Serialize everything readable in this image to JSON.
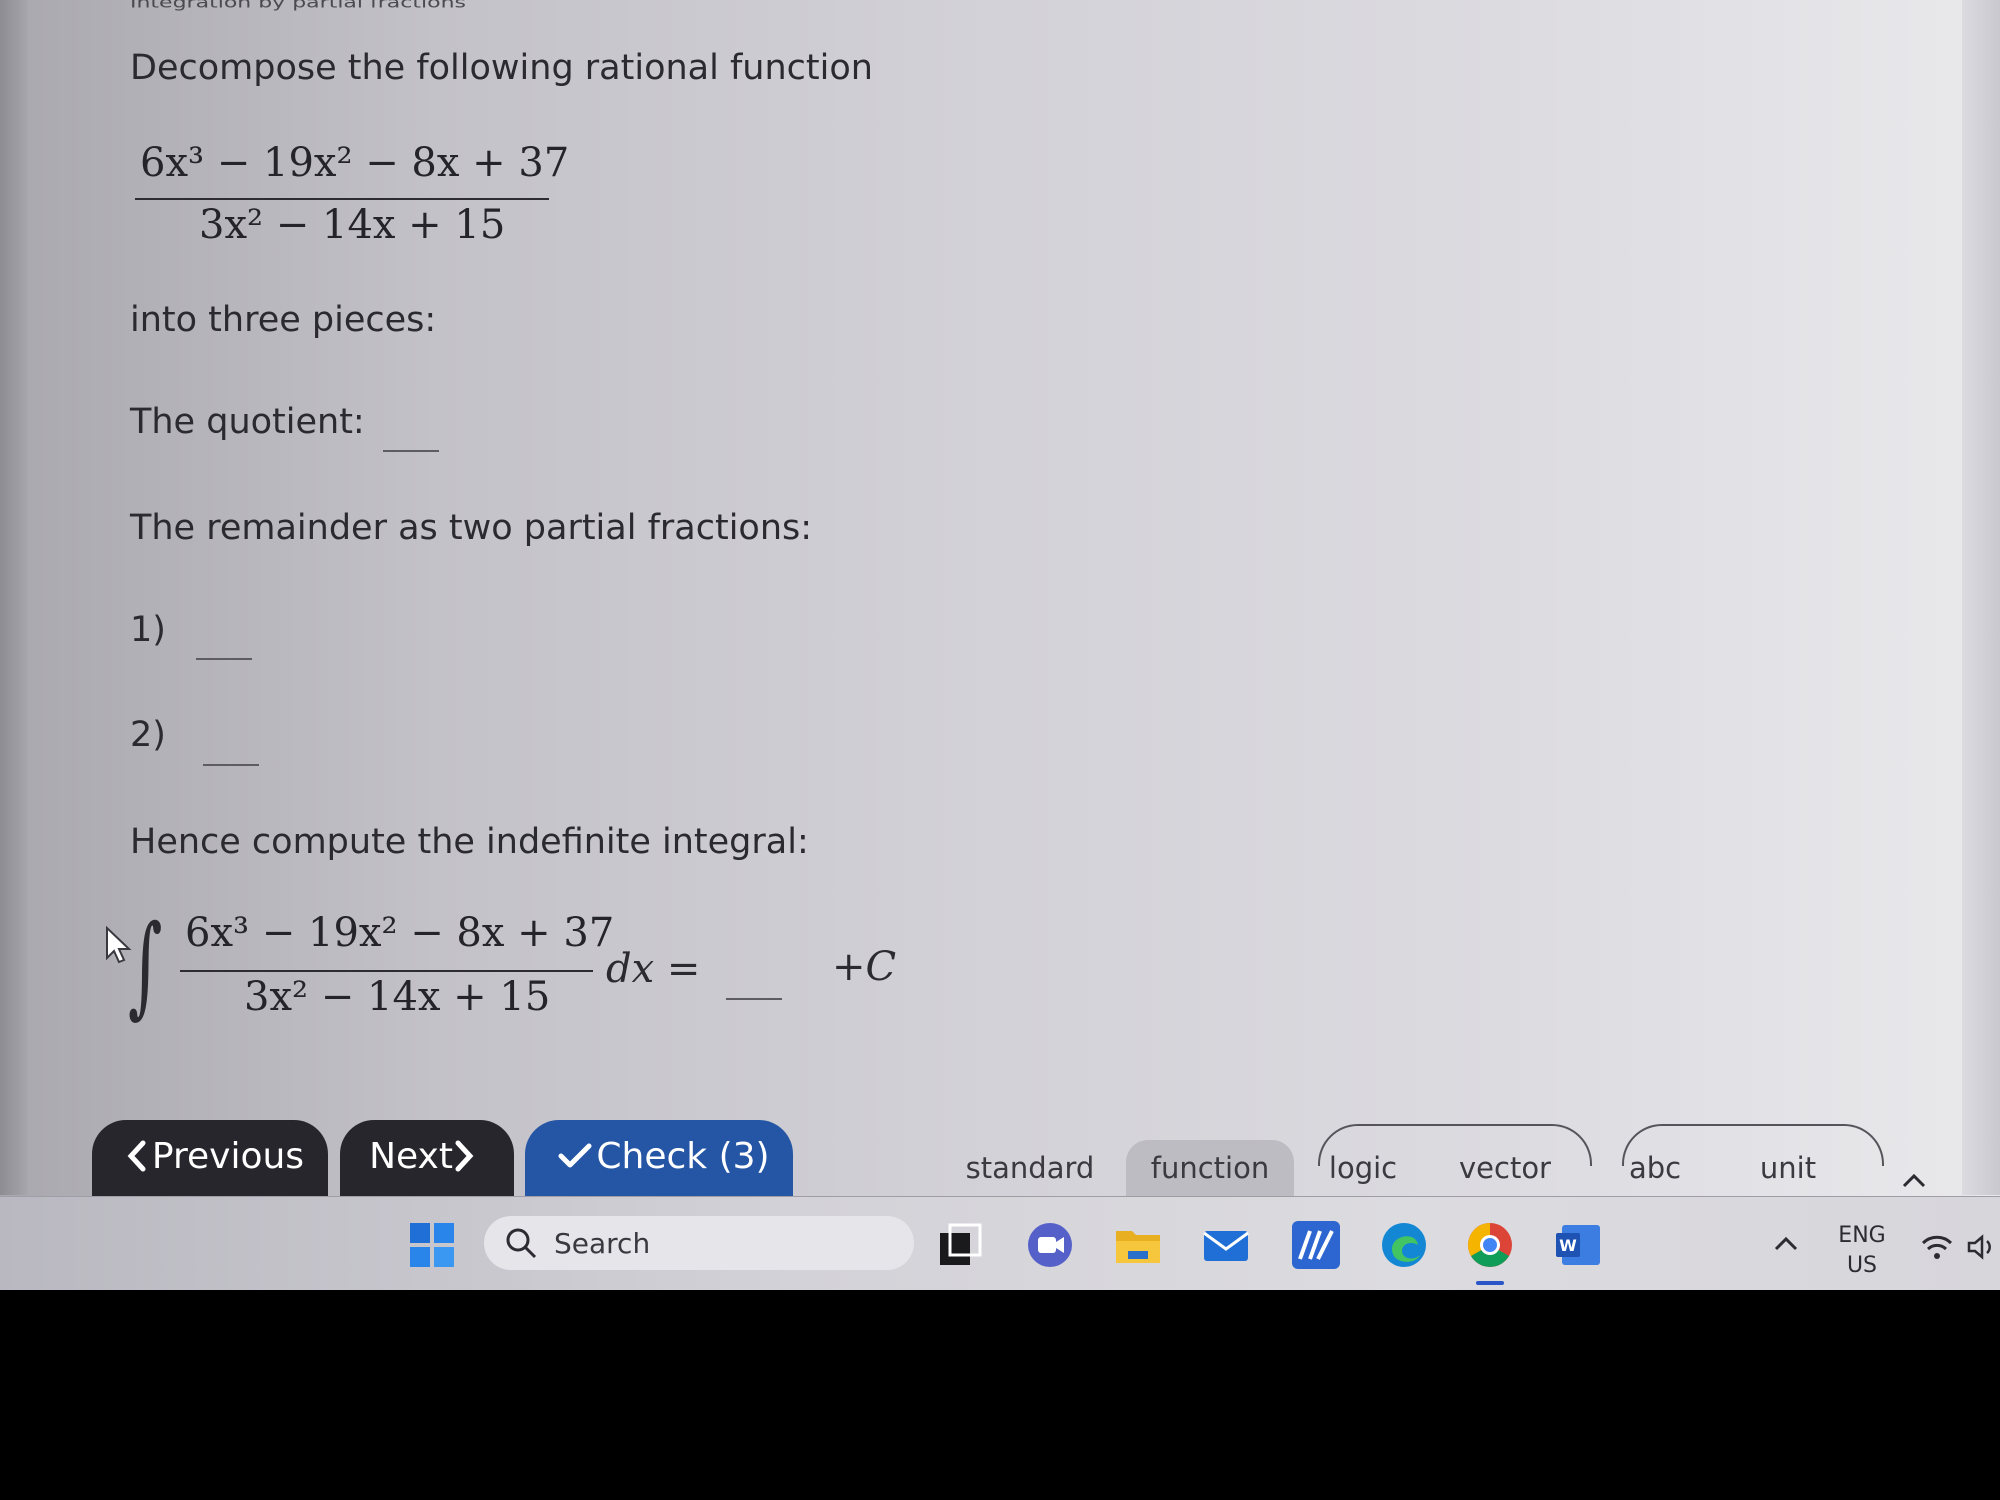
{
  "page": {
    "title": "Integration by partial fractions",
    "prompt": "Decompose the following rational function",
    "fraction": {
      "numerator": "6x³ − 19x² − 8x + 37",
      "denominator": "3x² − 14x + 15"
    },
    "into": "into three pieces:",
    "quotient_label": "The quotient:",
    "remainder_label": "The remainder as two partial fractions:",
    "item1_label": "1)",
    "item2_label": "2)",
    "integral_prompt": "Hence compute the indefinite integral:",
    "integral": {
      "numerator": "6x³ − 19x² − 8x + 37",
      "denominator": "3x² − 14x + 15",
      "dx": "dx =",
      "constant": "+C"
    }
  },
  "nav": {
    "previous": "Previous",
    "next": "Next",
    "check": "Check (3)"
  },
  "keyboard_tabs": [
    "standard",
    "function",
    "logic",
    "vector",
    "abc",
    "unit"
  ],
  "active_tab": "function",
  "taskbar": {
    "search_placeholder": "Search",
    "lang_top": "ENG",
    "lang_bottom": "US"
  },
  "colors": {
    "accent": "#2556a5",
    "button_dark": "#27262c"
  },
  "icons": [
    "windows-start-icon",
    "search-icon",
    "task-view-icon",
    "meet-icon",
    "file-explorer-icon",
    "mail-icon",
    "mathtype-icon",
    "edge-icon",
    "chrome-icon",
    "word-icon",
    "chevron-up-icon",
    "wifi-icon",
    "speaker-icon"
  ]
}
